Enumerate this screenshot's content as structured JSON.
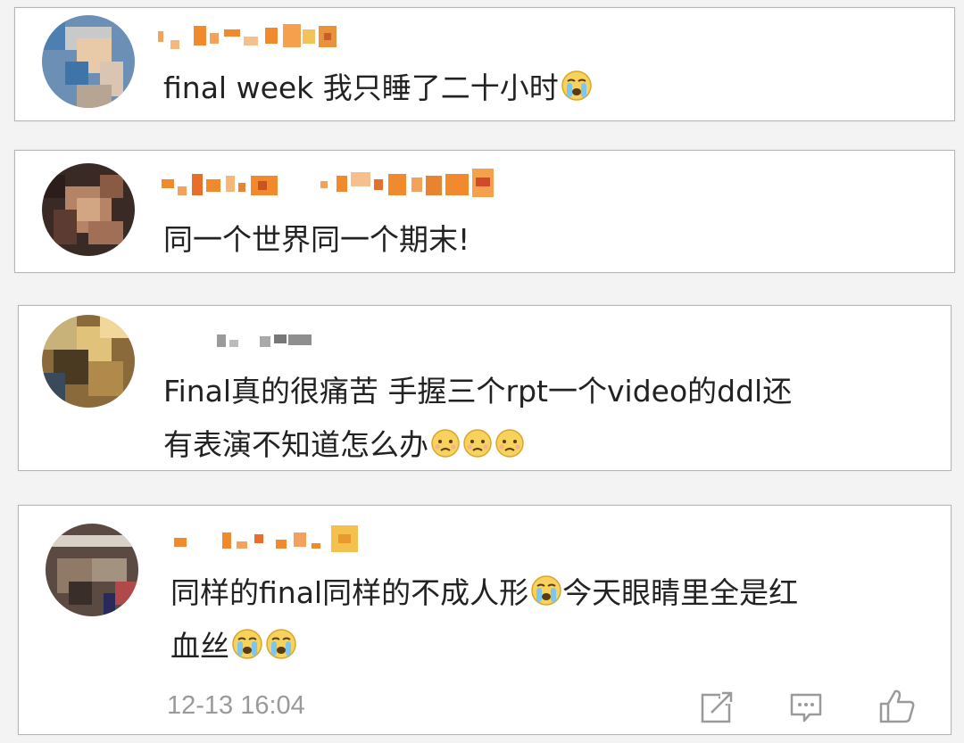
{
  "comments": [
    {
      "text": "final week 我只睡了二十小时",
      "emojis": [
        "crying-face-icon"
      ]
    },
    {
      "text": "同一个世界同一个期末!",
      "emojis": []
    },
    {
      "line1": "Final真的很痛苦 手握三个rpt一个video的ddl还",
      "line2": "有表演不知道怎么办",
      "emojis": [
        "worried-face-icon",
        "worried-face-icon",
        "worried-face-icon"
      ]
    },
    {
      "line1a": "同样的final同样的不成人形",
      "line1b": "今天眼睛里全是红",
      "line2": "血丝",
      "emojis": [
        "crying-face-icon",
        "crying-face-icon",
        "crying-face-icon"
      ]
    }
  ],
  "footer": {
    "timestamp": "12-13 16:04",
    "actions": [
      "repost-icon",
      "comment-icon",
      "like-icon"
    ]
  },
  "colors": {
    "username_orange": "#f08a2c",
    "text": "#222222",
    "muted": "#9a9a9a"
  }
}
